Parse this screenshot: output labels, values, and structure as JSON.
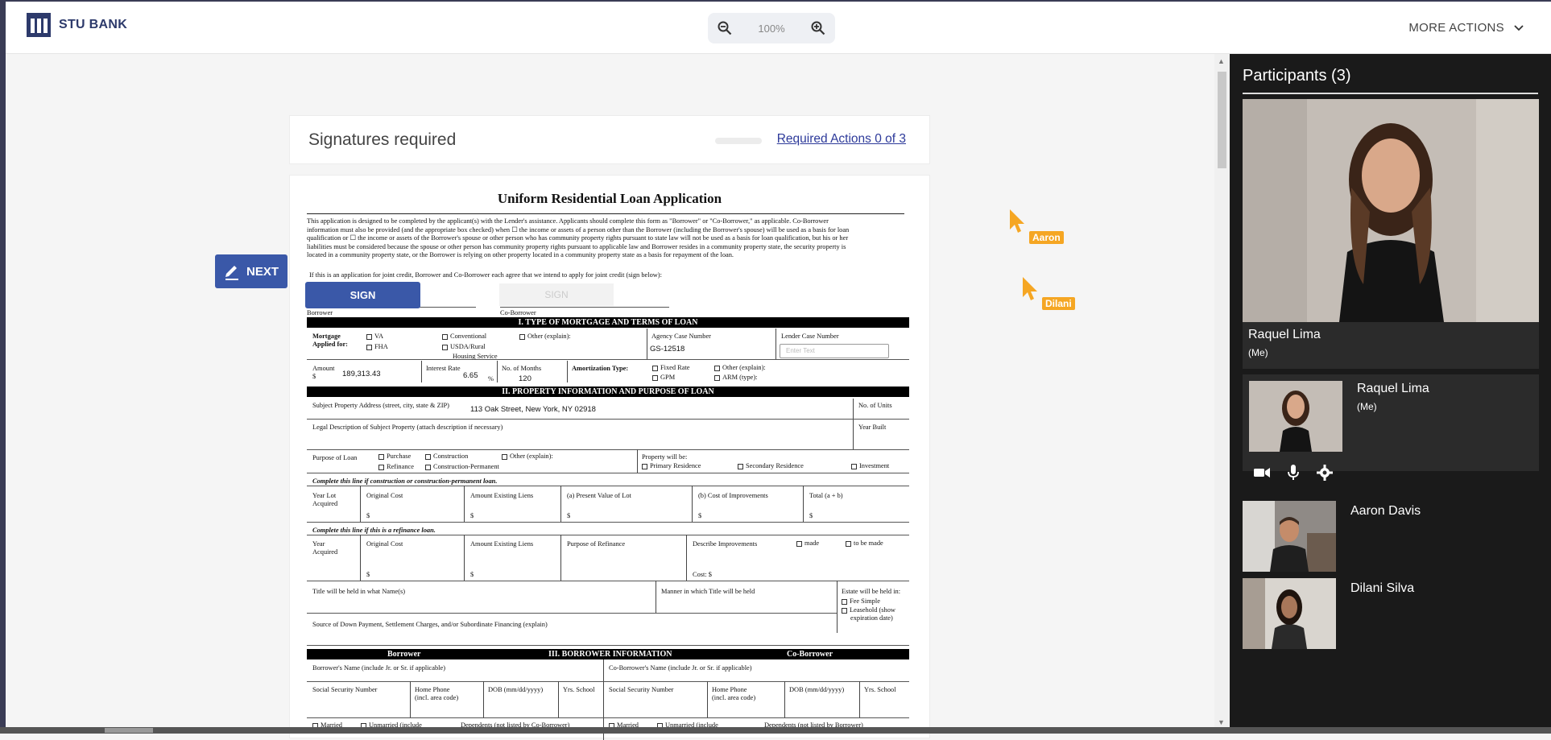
{
  "app": {
    "logo_text": "STU BANK"
  },
  "toolbar": {
    "zoom_value": "100%",
    "more_actions": "MORE ACTIONS"
  },
  "signatures": {
    "title": "Signatures required",
    "required_actions": "Required Actions 0 of 3"
  },
  "buttons": {
    "next": "NEXT",
    "sign": "SIGN",
    "sign_disabled": "SIGN"
  },
  "cursors": [
    {
      "name": "Aaron"
    },
    {
      "name": "Dilani"
    }
  ],
  "document": {
    "title": "Uniform Residential Loan Application",
    "intro_lines": [
      "This application is designed to be completed by the applicant(s) with the Lender's assistance. Applicants should complete this form as \"Borrower\" or \"Co-Borrower,\" as applicable. Co-Borrower",
      "information must also be provided (and the appropriate box checked) when ☐ the income or assets of a person other than the Borrower (including the Borrower's spouse) will be used as a basis for loan",
      "qualification or ☐ the income or assets of the Borrower's spouse or other person who has community property rights pursuant to state law will not be used as a basis for loan qualification, but his or her",
      "liabilities must be considered because the spouse or other person has community property rights pursuant to applicable law and Borrower resides in a community property state, the security property is",
      "located in a community property state, or the Borrower is relying on other property located in a community property state as a basis for repayment of the loan."
    ],
    "joint_credit": "If this is an application for joint credit, Borrower and Co-Borrower each agree that we intend to apply for joint credit (sign below):",
    "borrower_label": "Borrower",
    "coborrower_label": "Co-Borrower",
    "section1": "I. TYPE OF MORTGAGE AND TERMS OF LOAN",
    "mortgage_applied_for": "Mortgage\nApplied for:",
    "mortgage_types": [
      "VA",
      "FHA",
      "Conventional",
      "USDA/Rural",
      "Housing Service",
      "Other (explain):"
    ],
    "agency_case_number_label": "Agency Case Number",
    "agency_case_number": "GS-12518",
    "lender_case_number_label": "Lender Case Number",
    "lender_placeholder": "Enter Text",
    "amount_label": "Amount",
    "amount_currency": "$",
    "amount": "189,313.43",
    "interest_rate_label": "Interest Rate",
    "interest_rate": "6.65",
    "interest_unit": "%",
    "months_label": "No. of Months",
    "months": "120",
    "amortization_label": "Amortization Type:",
    "amortization_opts": [
      "Fixed Rate",
      "GPM",
      "Other (explain):",
      "ARM (type):"
    ],
    "section2": "II. PROPERTY INFORMATION AND PURPOSE OF LOAN",
    "subject_address_label": "Subject Property Address (street, city, state & ZIP)",
    "subject_address": "113 Oak Street, New York, NY 02918",
    "units_label": "No. of Units",
    "legal_desc_label": "Legal Description of Subject Property (attach description if necessary)",
    "year_built_label": "Year Built",
    "purpose_label": "Purpose of Loan",
    "purpose_opts": [
      "Purchase",
      "Construction",
      "Other (explain):",
      "Refinance",
      "Construction-Permanent"
    ],
    "property_will_be": "Property will be:",
    "property_opts": [
      "Primary Residence",
      "Secondary Residence",
      "Investment"
    ],
    "construction_line": "Complete this line if construction or construction-permanent loan.",
    "construction_cols": [
      "Year Lot\nAcquired",
      "Original Cost",
      "Amount Existing Liens",
      "(a) Present Value of Lot",
      "(b) Cost of Improvements",
      "Total (a + b)"
    ],
    "refinance_line": "Complete this line if this is a refinance loan.",
    "refinance_cols": [
      "Year\nAcquired",
      "Original Cost",
      "Amount Existing Liens",
      "Purpose of Refinance",
      "Describe Improvements"
    ],
    "refinance_opts": [
      "made",
      "to be made"
    ],
    "cost_label": "Cost: $",
    "dollar": "$",
    "title_names_label": "Title will be held in what Name(s)",
    "manner_label": "Manner in which Title will be held",
    "estate_label": "Estate will be held in:",
    "estate_opts": [
      "Fee Simple",
      "Leasehold (show",
      "expiration date)"
    ],
    "source_label": "Source of Down Payment, Settlement Charges, and/or Subordinate Financing (explain)",
    "section3_left": "Borrower",
    "section3": "III. BORROWER INFORMATION",
    "section3_right": "Co-Borrower",
    "borrower_name_label": "Borrower's Name (include Jr. or Sr. if applicable)",
    "coborrower_name_label": "Co-Borrower's Name (include Jr. or Sr. if applicable)",
    "ssn_label": "Social Security Number",
    "home_phone_label": "Home Phone\n(incl. area code)",
    "dob_label": "DOB (mm/dd/yyyy)",
    "yrs_school_label": "Yrs. School",
    "married_row": [
      "Married",
      "Unmarried (include",
      "Dependents (not listed by Co-Borrower)",
      "Married",
      "Unmarried (include",
      "Dependents (not listed by Borrower)"
    ]
  },
  "participants": {
    "title": "Participants (3)",
    "main": {
      "name": "Raquel Lima",
      "tag": "(Me)"
    },
    "list": [
      {
        "name": "Raquel Lima",
        "tag": "(Me)"
      },
      {
        "name": "Aaron Davis",
        "tag": ""
      },
      {
        "name": "Dilani Silva",
        "tag": ""
      }
    ],
    "controls": [
      "video-camera-icon",
      "microphone-icon",
      "settings-gear-icon"
    ]
  }
}
